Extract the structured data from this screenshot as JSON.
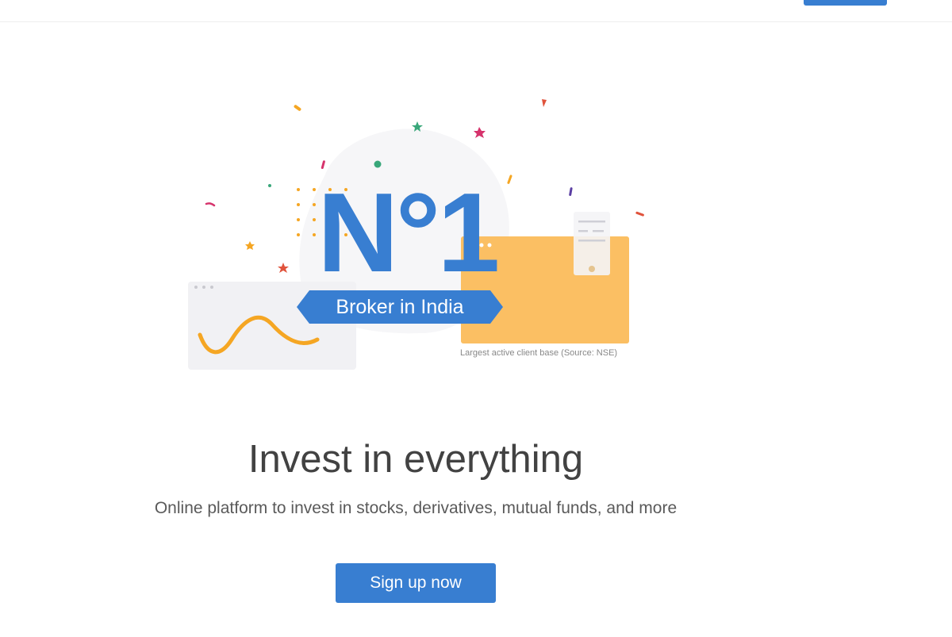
{
  "hero": {
    "big_number": "N°1",
    "badge": "Broker in India",
    "caption": "Largest active client base (Source: NSE)"
  },
  "headline": "Invest in everything",
  "subline": "Online platform to invest in stocks, derivatives, mutual funds, and more",
  "cta": {
    "label": "Sign up now"
  },
  "colors": {
    "brand_blue": "#387ed1",
    "card_orange": "#fbbf63",
    "card_grey": "#f1f1f4",
    "wave": "#f5a623",
    "heading_text": "#424242"
  },
  "icons": {
    "confetti": "confetti-decoration",
    "wave": "wave-chart-icon",
    "window_dots": "window-dots-icon"
  }
}
